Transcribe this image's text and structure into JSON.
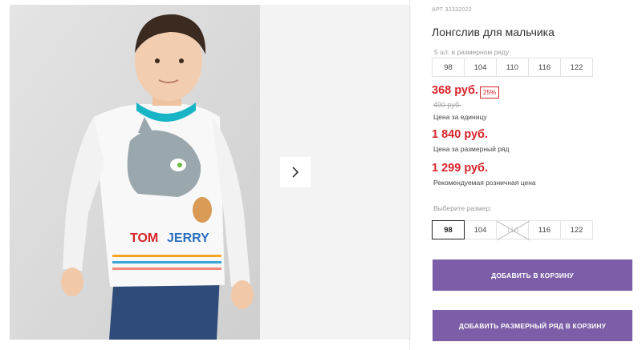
{
  "product": {
    "sku": "АРТ 32332022",
    "title": "Лонгслив для мальчика",
    "row_note": "5 шт. в размерном ряду",
    "row_sizes": [
      "98",
      "104",
      "110",
      "116",
      "122"
    ]
  },
  "pricing": {
    "unit_price": "368 руб.",
    "discount": "25%",
    "old_price": "490 руб.",
    "unit_label": "Цена за единицу",
    "row_price": "1 840 руб.",
    "row_label": "Цена за размерный ряд",
    "rrp_price": "1 299 руб.",
    "rrp_label": "Рекомендуемая розничная цена"
  },
  "size_select": {
    "label": "Выберите размер:",
    "options": [
      "98",
      "104",
      "110",
      "116",
      "122"
    ],
    "selected": "98",
    "unavailable": "110"
  },
  "actions": {
    "add_to_cart": "ДОБАВИТЬ В КОРЗИНУ",
    "add_row_to_cart": "ДОБАВИТЬ РАЗМЕРНЫЙ РЯД В КОРЗИНУ"
  },
  "gallery": {
    "next_icon": "chevron-right-icon",
    "logo_text": "TOM and JERRY"
  },
  "colors": {
    "price": "#d8232a",
    "button": "#7b5ea7",
    "collar": "#19b5c6"
  }
}
